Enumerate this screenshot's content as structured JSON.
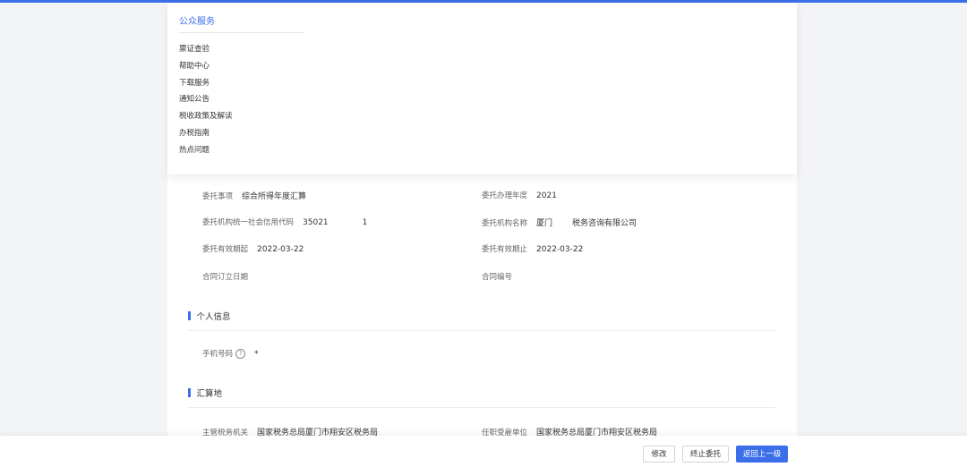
{
  "public_service": {
    "title": "公众服务",
    "items": [
      "票证查验",
      "帮助中心",
      "下载服务",
      "通知公告",
      "税收政策及解读",
      "办税指南",
      "热点问题"
    ]
  },
  "delegation": {
    "matter_label": "委托事项",
    "matter_value": "综合所得年度汇算",
    "year_label": "委托办理年度",
    "year_value": "2021",
    "credit_code_label": "委托机构统一社会信用代码",
    "credit_code_prefix": "35021",
    "credit_code_suffix": "1",
    "org_name_label": "委托机构名称",
    "org_name_prefix": "厦门",
    "org_name_suffix": "税务咨询有限公司",
    "start_label": "委托有效期起",
    "start_value": "2022-03-22",
    "end_label": "委托有效期止",
    "end_value": "2022-03-22",
    "contract_date_label": "合同订立日期",
    "contract_no_label": "合同编号"
  },
  "personal": {
    "section_title": "个人信息",
    "phone_label": "手机号码",
    "phone_value": "*"
  },
  "settlement": {
    "section_title": "汇算地",
    "tax_authority_label": "主管税务机关",
    "tax_authority_value": "国家税务总局厦门市翔安区税务局",
    "employer_label": "任职受雇单位",
    "employer_value": "国家税务总局厦门市翔安区税务局"
  },
  "footer": {
    "modify": "修改",
    "terminate": "终止委托",
    "back": "返回上一级"
  },
  "colors": {
    "accent": "#3b6ee8"
  },
  "icons": {
    "help": "question-circle-icon"
  }
}
